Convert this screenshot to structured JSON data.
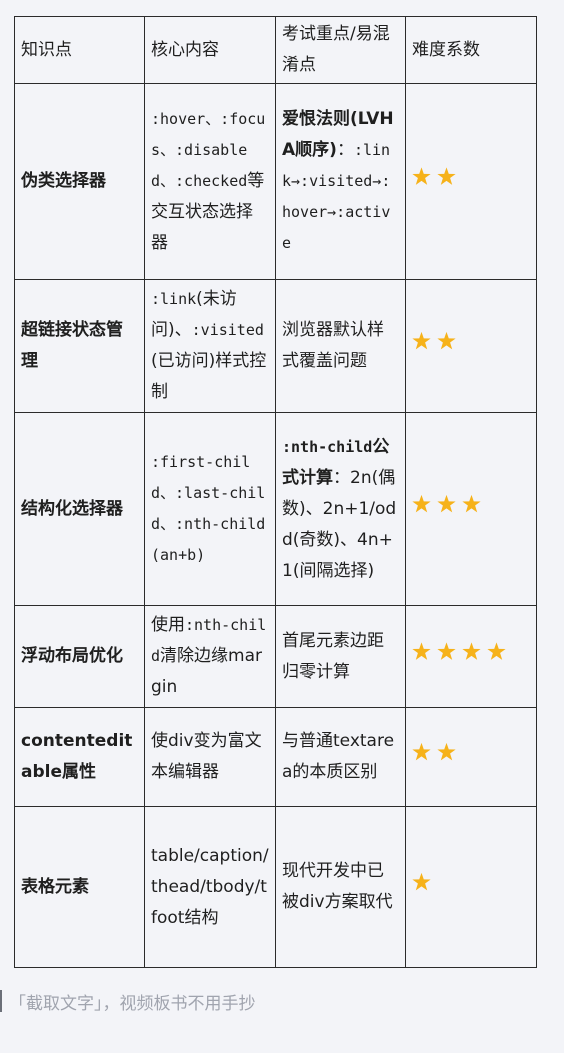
{
  "table": {
    "headers": [
      "知识点",
      "核心内容",
      "考试重点/易混淆点",
      "难度系数"
    ],
    "rows": [
      {
        "topic": "伪类选择器",
        "core_code": ":hover、:focus、:disabled、:checked",
        "core_text": "等交互状态选择器",
        "focus_bold": "爱恨法则(LVHA顺序)",
        "focus_text": "：",
        "focus_code": ":link→:visited→:hover→:active",
        "stars": 2
      },
      {
        "topic": "超链接状态管理",
        "core_code_1": ":link",
        "core_text_1": "(未访问)、",
        "core_code_2": ":visited",
        "core_text_2": "(已访问)样式控制",
        "focus_text": "浏览器默认样式覆盖问题",
        "stars": 2
      },
      {
        "topic": "结构化选择器",
        "core_code": ":first-child、:last-child、:nth-child(an+b)",
        "focus_bold_code": ":nth-child",
        "focus_bold": "公式计算",
        "focus_text": "：2n(偶数)、2n+1/odd(奇数)、4n+1(间隔选择)",
        "stars": 3
      },
      {
        "topic": "浮动布局优化",
        "core_text_1": "使用",
        "core_code": ":nth-child",
        "core_text_2": "清除边缘margin",
        "focus_text": "首尾元素边距归零计算",
        "stars": 4
      },
      {
        "topic": "contenteditable属性",
        "core_text": "使div变为富文本编辑器",
        "focus_text": "与普通textarea的本质区别",
        "stars": 2
      },
      {
        "topic": "表格元素",
        "core_text": "table/caption/thead/tbody/tfoot结构",
        "focus_text": "现代开发中已被div方案取代",
        "stars": 1
      }
    ]
  },
  "footer": {
    "text": "「截取文字」，视频板书不用手抄"
  }
}
